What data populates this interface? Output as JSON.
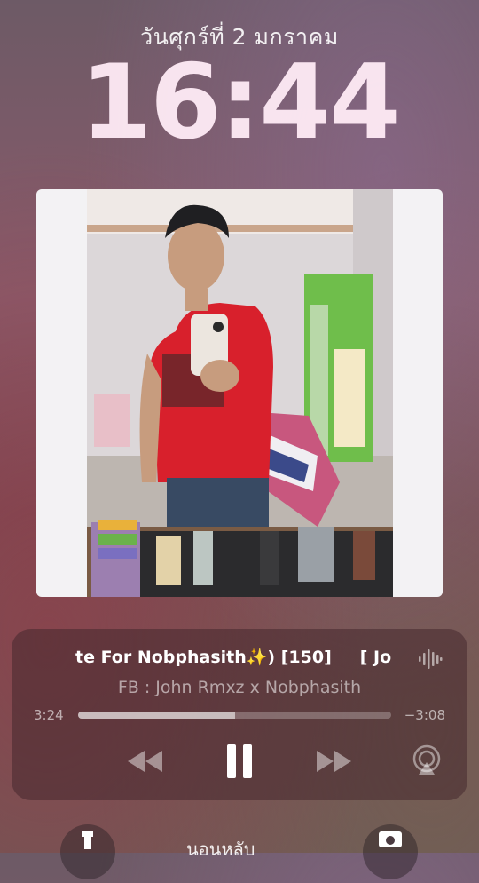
{
  "lock_screen": {
    "date": "วันศุกร์ที่ 2 มกราคม",
    "time": "16:44"
  },
  "now_playing": {
    "title_visible": "te For Nobphasith✨) [150]",
    "title_repeat_visible": "[ Jo",
    "artist": "FB : John Rmxz x Nobphasith",
    "elapsed": "3:24",
    "remaining": "−3:08",
    "progress_fraction": 0.5,
    "controls": [
      "rewind-icon",
      "pause-icon",
      "fast-forward-icon",
      "airplay-icon",
      "waveform-icon"
    ]
  },
  "bottom_bar": {
    "label": "นอนหลับ",
    "left_icon": "flashlight-icon",
    "right_icon": "camera-icon"
  }
}
